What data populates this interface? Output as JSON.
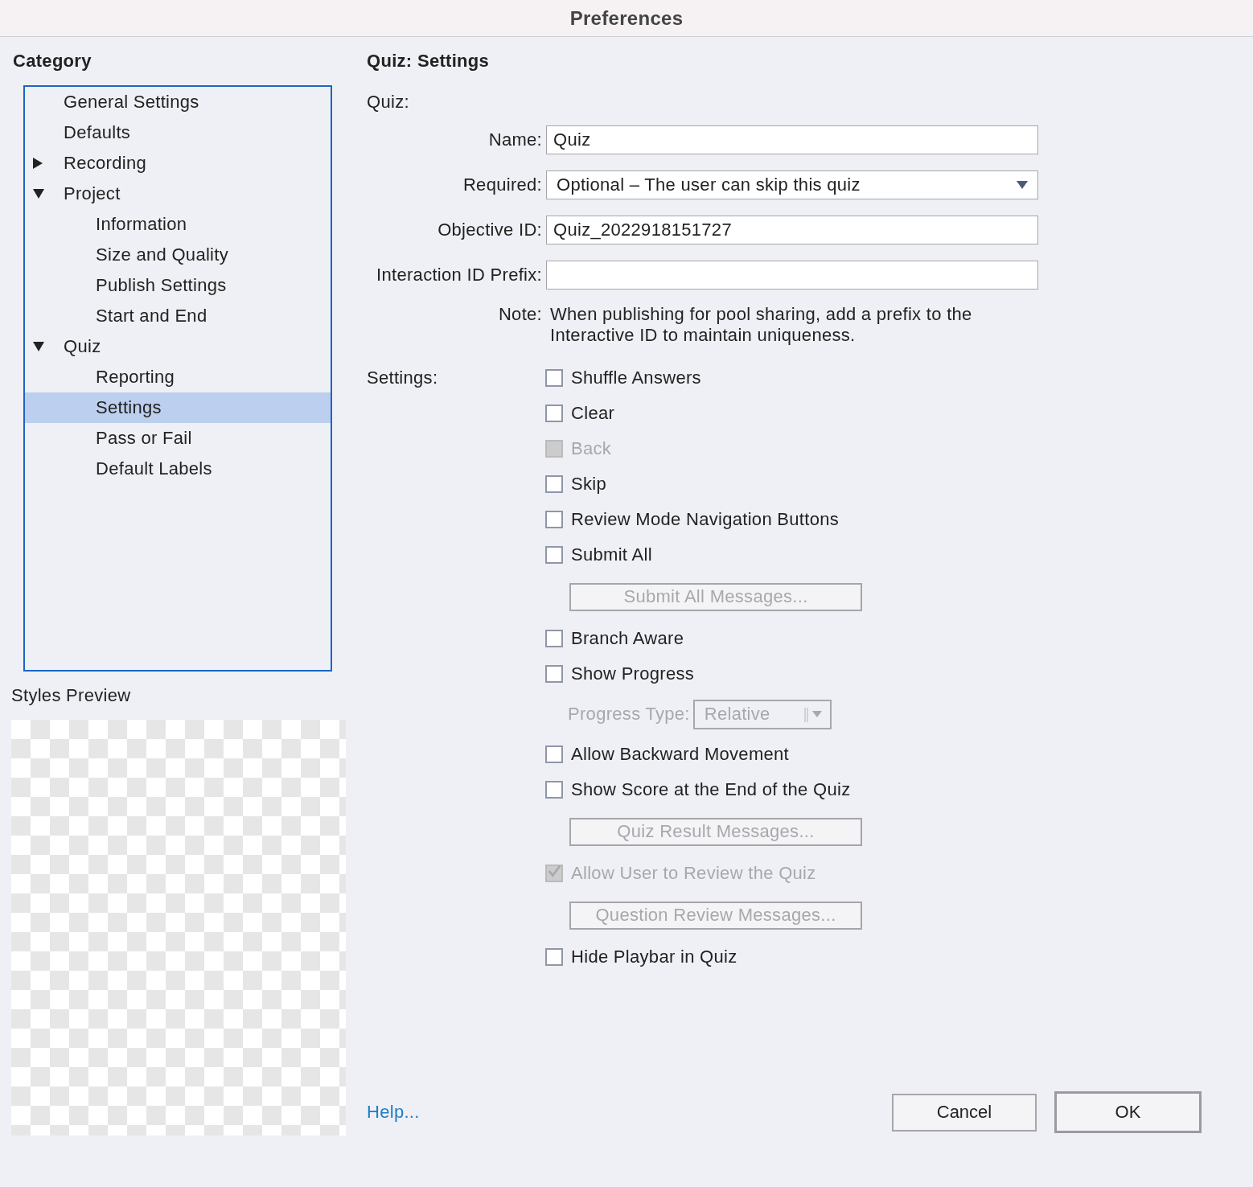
{
  "window": {
    "title": "Preferences"
  },
  "sidebar": {
    "heading": "Category",
    "items": [
      {
        "label": "General Settings",
        "selected": false
      },
      {
        "label": "Defaults",
        "selected": false
      },
      {
        "label": "Recording",
        "selected": false,
        "expanded": false
      },
      {
        "label": "Project",
        "selected": false,
        "expanded": true,
        "children": [
          {
            "label": "Information",
            "selected": false
          },
          {
            "label": "Size and Quality",
            "selected": false
          },
          {
            "label": "Publish Settings",
            "selected": false
          },
          {
            "label": "Start and End",
            "selected": false
          }
        ]
      },
      {
        "label": "Quiz",
        "selected": false,
        "expanded": true,
        "children": [
          {
            "label": "Reporting",
            "selected": false
          },
          {
            "label": "Settings",
            "selected": true
          },
          {
            "label": "Pass or Fail",
            "selected": false
          },
          {
            "label": "Default Labels",
            "selected": false
          }
        ]
      }
    ],
    "preview_label": "Styles Preview"
  },
  "panel": {
    "title": "Quiz: Settings",
    "section": "Quiz:",
    "fields": [
      {
        "kind": "text",
        "label": "Name:",
        "value": "Quiz"
      },
      {
        "kind": "select",
        "label": "Required:",
        "value": "Optional – The user can skip this quiz"
      },
      {
        "kind": "text",
        "label": "Objective ID:",
        "value": "Quiz_2022918151727"
      },
      {
        "kind": "text",
        "label": "Interaction ID Prefix:"
      }
    ],
    "note": {
      "label": "Note:",
      "text": "When publishing for pool sharing, add a prefix to the Interactive ID to maintain uniqueness."
    },
    "settings_label": "Settings:",
    "settings": [
      {
        "kind": "checkbox",
        "label": "Shuffle Answers",
        "checked": false,
        "disabled": false
      },
      {
        "kind": "checkbox",
        "label": "Clear",
        "checked": false,
        "disabled": false
      },
      {
        "kind": "checkbox",
        "label": "Back",
        "checked": false,
        "disabled": true
      },
      {
        "kind": "checkbox",
        "label": "Skip",
        "checked": false,
        "disabled": false
      },
      {
        "kind": "checkbox",
        "label": "Review Mode Navigation Buttons",
        "checked": false,
        "disabled": false
      },
      {
        "kind": "checkbox",
        "label": "Submit All",
        "checked": false,
        "disabled": false
      },
      {
        "kind": "button",
        "label": "Submit All Messages...",
        "disabled": true
      },
      {
        "kind": "checkbox",
        "label": "Branch Aware",
        "checked": false,
        "disabled": false
      },
      {
        "kind": "checkbox",
        "label": "Show Progress",
        "checked": false,
        "disabled": false
      },
      {
        "kind": "dropdown",
        "label": "Progress Type:",
        "value": "Relative",
        "disabled": true
      },
      {
        "kind": "checkbox",
        "label": "Allow Backward Movement",
        "checked": false,
        "disabled": false
      },
      {
        "kind": "checkbox",
        "label": "Show Score at the End of the Quiz",
        "checked": false,
        "disabled": false
      },
      {
        "kind": "button",
        "label": "Quiz Result Messages...",
        "disabled": true
      },
      {
        "kind": "checkbox",
        "label": "Allow User to Review the Quiz",
        "checked": true,
        "disabled": true
      },
      {
        "kind": "button",
        "label": "Question Review Messages...",
        "disabled": true
      },
      {
        "kind": "checkbox",
        "label": "Hide Playbar in Quiz",
        "checked": false,
        "disabled": false
      }
    ]
  },
  "footer": {
    "help": "Help...",
    "buttons": [
      {
        "label": "Cancel",
        "default": false
      },
      {
        "label": "OK",
        "default": true
      }
    ]
  }
}
